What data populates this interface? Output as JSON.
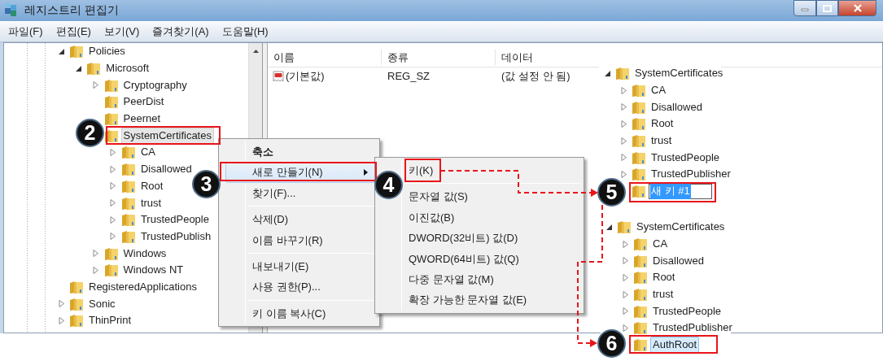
{
  "window": {
    "title": "레지스트리 편집기"
  },
  "menu_bar": [
    "파일(F)",
    "편집(E)",
    "보기(V)",
    "즐겨찾기(A)",
    "도움말(H)"
  ],
  "tree": [
    {
      "label": "Policies",
      "expanded": true,
      "selected": false,
      "children": [
        {
          "label": "Microsoft",
          "expanded": true,
          "selected": false,
          "children": [
            {
              "label": "Cryptography",
              "expanded": false,
              "selected": false
            },
            {
              "label": "PeerDist",
              "selected": false
            },
            {
              "label": "Peernet",
              "selected": false
            },
            {
              "label": "SystemCertificates",
              "selected": true,
              "children": [
                {
                  "label": "CA",
                  "expanded": false,
                  "selected": false
                },
                {
                  "label": "Disallowed",
                  "expanded": false,
                  "selected": false
                },
                {
                  "label": "Root",
                  "expanded": false,
                  "selected": false
                },
                {
                  "label": "trust",
                  "expanded": false,
                  "selected": false
                },
                {
                  "label": "TrustedPeople",
                  "expanded": false,
                  "selected": false
                },
                {
                  "label": "TrustedPublish",
                  "expanded": false,
                  "selected": false
                }
              ]
            },
            {
              "label": "Windows",
              "expanded": false,
              "selected": false
            },
            {
              "label": "Windows NT",
              "expanded": false,
              "selected": false
            }
          ]
        }
      ]
    },
    {
      "label": "RegisteredApplications",
      "selected": false
    },
    {
      "label": "Sonic",
      "expanded": false,
      "selected": false
    },
    {
      "label": "ThinPrint",
      "expanded": false,
      "selected": false
    }
  ],
  "values_list": {
    "columns": [
      "이름",
      "종류",
      "데이터"
    ],
    "rows": [
      {
        "name": "(기본값)",
        "type": "REG_SZ",
        "data": "(값 설정 안 됨)"
      }
    ]
  },
  "context_menu": {
    "items": [
      {
        "kind": "item",
        "label": "축소",
        "default": true,
        "selected": false,
        "submenu": false
      },
      {
        "kind": "item",
        "label": "새로 만들기(N)",
        "default": false,
        "selected": true,
        "submenu": true
      },
      {
        "kind": "item",
        "label": "찾기(F)...",
        "default": false,
        "selected": false,
        "submenu": false
      },
      {
        "kind": "separator"
      },
      {
        "kind": "item",
        "label": "삭제(D)",
        "default": false,
        "selected": false,
        "submenu": false
      },
      {
        "kind": "item",
        "label": "이름 바꾸기(R)",
        "default": false,
        "selected": false,
        "submenu": false
      },
      {
        "kind": "separator"
      },
      {
        "kind": "item",
        "label": "내보내기(E)",
        "default": false,
        "selected": false,
        "submenu": false
      },
      {
        "kind": "item",
        "label": "사용 권한(P)...",
        "default": false,
        "selected": false,
        "submenu": false
      },
      {
        "kind": "separator"
      },
      {
        "kind": "item",
        "label": "키 이름 복사(C)",
        "default": false,
        "selected": false,
        "submenu": false
      }
    ]
  },
  "submenu": {
    "items": [
      {
        "kind": "item",
        "label": "키(K)",
        "default": false,
        "selected": false,
        "submenu": false
      },
      {
        "kind": "separator"
      },
      {
        "kind": "item",
        "label": "문자열 값(S)",
        "default": false,
        "selected": false,
        "submenu": false
      },
      {
        "kind": "item",
        "label": "이진값(B)",
        "default": false,
        "selected": false,
        "submenu": false
      },
      {
        "kind": "item",
        "label": "DWORD(32비트) 값(D)",
        "default": false,
        "selected": false,
        "submenu": false
      },
      {
        "kind": "item",
        "label": "QWORD(64비트) 값(Q)",
        "default": false,
        "selected": false,
        "submenu": false
      },
      {
        "kind": "item",
        "label": "다중 문자열 값(M)",
        "default": false,
        "selected": false,
        "submenu": false
      },
      {
        "kind": "item",
        "label": "확장 가능한 문자열 값(E)",
        "default": false,
        "selected": false,
        "submenu": false
      }
    ]
  },
  "callouts": [
    {
      "tree": [
        {
          "label": "SystemCertificates",
          "expanded": true,
          "selected": false,
          "editing": false,
          "children": [
            {
              "label": "CA",
              "expanded": false,
              "selected": false,
              "editing": false
            },
            {
              "label": "Disallowed",
              "expanded": false,
              "selected": false,
              "editing": false
            },
            {
              "label": "Root",
              "expanded": false,
              "selected": false,
              "editing": false
            },
            {
              "label": "trust",
              "expanded": false,
              "selected": false,
              "editing": false
            },
            {
              "label": "TrustedPeople",
              "expanded": false,
              "selected": false,
              "editing": false
            },
            {
              "label": "TrustedPublisher",
              "expanded": false,
              "selected": false,
              "editing": false
            },
            {
              "label": "새 키 #1",
              "selected": true,
              "editing": true
            }
          ]
        }
      ]
    },
    {
      "tree": [
        {
          "label": "SystemCertificates",
          "expanded": true,
          "selected": false,
          "editing": false,
          "children": [
            {
              "label": "CA",
              "expanded": false,
              "selected": false,
              "editing": false
            },
            {
              "label": "Disallowed",
              "expanded": false,
              "selected": false,
              "editing": false
            },
            {
              "label": "Root",
              "expanded": false,
              "selected": false,
              "editing": false
            },
            {
              "label": "trust",
              "expanded": false,
              "selected": false,
              "editing": false
            },
            {
              "label": "TrustedPeople",
              "expanded": false,
              "selected": false,
              "editing": false
            },
            {
              "label": "TrustedPublisher",
              "expanded": false,
              "selected": false,
              "editing": false
            },
            {
              "label": "AuthRoot",
              "selected": true,
              "editing": false
            }
          ]
        }
      ]
    }
  ],
  "steps": [
    "2",
    "3",
    "4",
    "5",
    "6"
  ]
}
